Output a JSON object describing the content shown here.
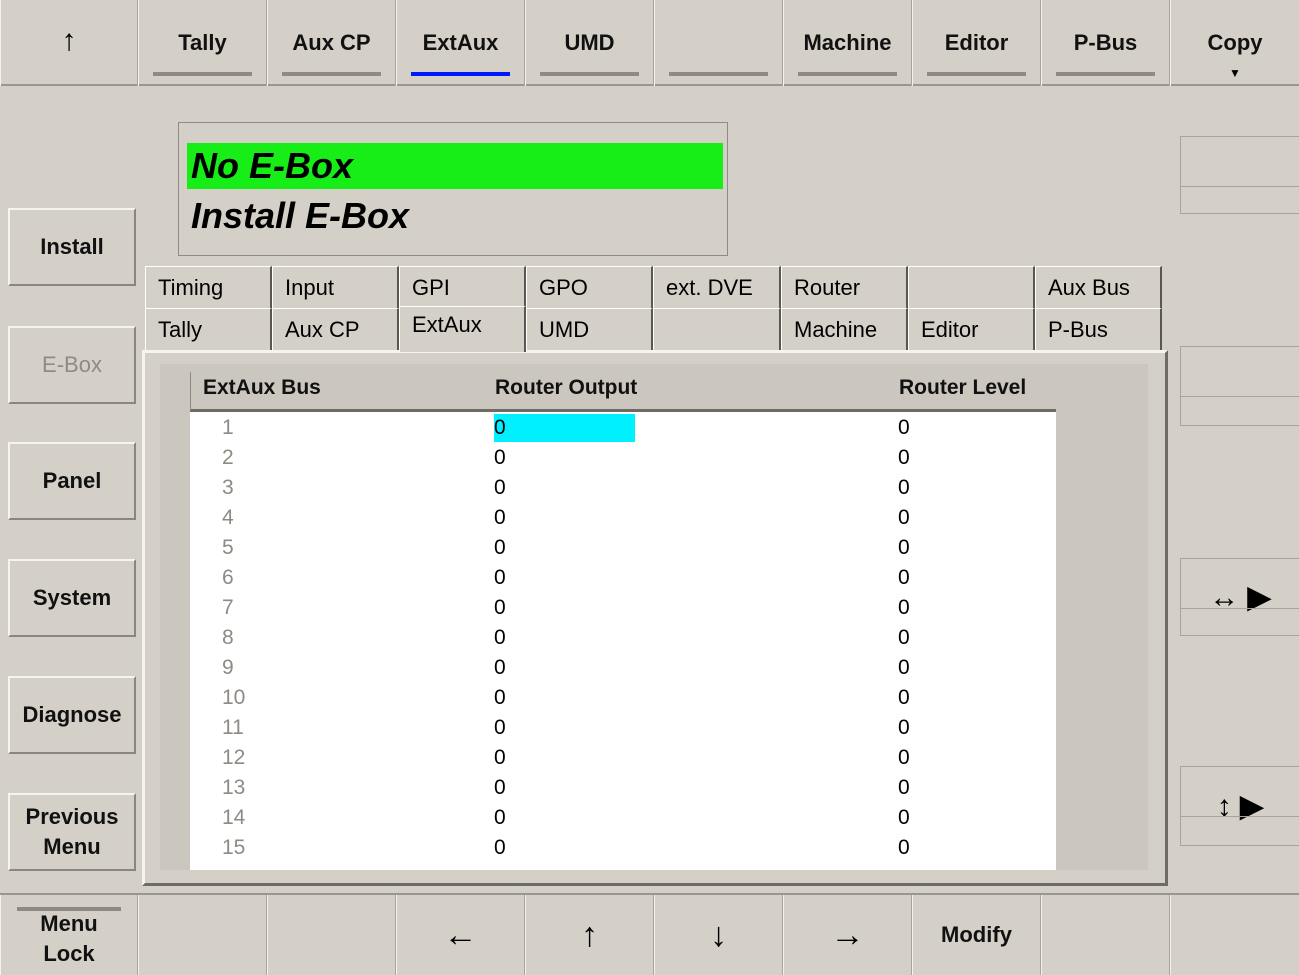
{
  "top_menu": {
    "up_icon": "↑",
    "tabs": [
      {
        "label": "Tally",
        "active": false
      },
      {
        "label": "Aux CP",
        "active": false
      },
      {
        "label": "ExtAux",
        "active": true
      },
      {
        "label": "UMD",
        "active": false
      },
      {
        "label": "",
        "active": false
      },
      {
        "label": "Machine",
        "active": false
      },
      {
        "label": "Editor",
        "active": false
      },
      {
        "label": "P-Bus",
        "active": false
      }
    ],
    "copy_label": "Copy",
    "copy_caret": "▼"
  },
  "left_menu": {
    "install": "Install",
    "ebox": "E-Box",
    "panel": "Panel",
    "system": "System",
    "diagnose": "Diagnose",
    "previous_menu": "Previous Menu"
  },
  "status": {
    "line1": "No E-Box",
    "line2": "Install E-Box"
  },
  "tabs_row1": [
    "Timing",
    "Input",
    "GPI",
    "GPO",
    "ext. DVE",
    "Router",
    "",
    "Aux Bus"
  ],
  "tabs_row2": [
    "Tally",
    "Aux CP",
    "ExtAux",
    "UMD",
    "",
    "Machine",
    "Editor",
    "P-Bus"
  ],
  "table": {
    "headers": [
      "ExtAux Bus",
      "Router Output",
      "Router Level"
    ],
    "rows": [
      [
        "1",
        "0",
        "0"
      ],
      [
        "2",
        "0",
        "0"
      ],
      [
        "3",
        "0",
        "0"
      ],
      [
        "4",
        "0",
        "0"
      ],
      [
        "5",
        "0",
        "0"
      ],
      [
        "6",
        "0",
        "0"
      ],
      [
        "7",
        "0",
        "0"
      ],
      [
        "8",
        "0",
        "0"
      ],
      [
        "9",
        "0",
        "0"
      ],
      [
        "10",
        "0",
        "0"
      ],
      [
        "11",
        "0",
        "0"
      ],
      [
        "12",
        "0",
        "0"
      ],
      [
        "13",
        "0",
        "0"
      ],
      [
        "14",
        "0",
        "0"
      ],
      [
        "15",
        "0",
        "0"
      ]
    ],
    "selected_row": 1
  },
  "right_menu": {
    "horizontal_icon": "↔ ▶",
    "vertical_icon": "↕ ▶"
  },
  "bottom_menu": {
    "menu_lock": "Menu Lock",
    "left_arrow": "←",
    "up_arrow": "↑",
    "down_arrow": "↓",
    "right_arrow": "→",
    "modify": "Modify"
  },
  "colors": {
    "background": "#d4d0c8",
    "status_green": "#17ee17",
    "selection_cyan": "#00f0ff",
    "active_tab_bar": "#0018ff"
  }
}
